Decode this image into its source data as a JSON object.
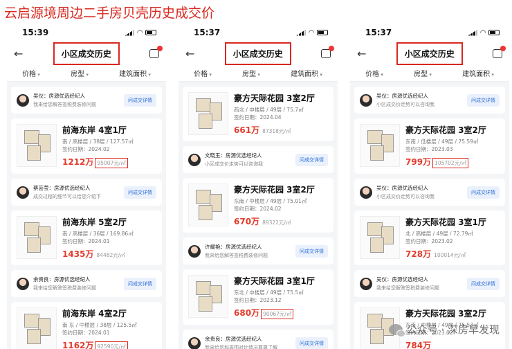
{
  "page_title": "云启源境周边二手房贝壳历史成交价",
  "phones": [
    {
      "time": "15:39",
      "nav_title": "小区成交历史",
      "filters": [
        "价格",
        "房型",
        "建筑面积"
      ],
      "cards": [
        {
          "kind": "agent",
          "name": "吴仪：房源优选经纪人",
          "desc": "我来给您解答签税费装修问题",
          "btn": "问成交详情"
        },
        {
          "kind": "listing",
          "title": "前海东岸 4室1厅",
          "spec": "南 / 高楼层 / 38层 / 127.57㎡",
          "date": "签约日期：2024.02",
          "total": "1212万",
          "unit": "95007元/㎡",
          "highlight": true
        },
        {
          "kind": "agent",
          "name": "蔡芸莹：房源优选经纪人",
          "desc": "成交过程的细节可以给您介绍下",
          "btn": "问成交详情"
        },
        {
          "kind": "listing",
          "title": "前海东岸 5室2厅",
          "spec": "南 / 高楼层 / 36层 / 169.86㎡",
          "date": "签约日期：2024.01",
          "total": "1435万",
          "unit": "84482元/㎡",
          "highlight": false
        },
        {
          "kind": "agent",
          "name": "余贵良：房源优选经纪人",
          "desc": "我来给您解答签税费装修问题",
          "btn": "问成交详情"
        },
        {
          "kind": "listing",
          "title": "前海东岸 4室2厅",
          "spec": "南 东 / 中楼层 / 38层 / 125.5㎡",
          "date": "签约日期：2024.01",
          "total": "1162万",
          "unit": "92590元/㎡",
          "highlight": true
        }
      ]
    },
    {
      "time": "15:37",
      "nav_title": "小区成交历史",
      "filters": [
        "价格",
        "房型",
        "建筑面积"
      ],
      "cards": [
        {
          "kind": "listing",
          "title": "豪方天际花园 3室2厅",
          "spec": "西北 / 中楼层 / 49层 / 75.7㎡",
          "date": "签约日期：2024.04",
          "total": "661万",
          "unit": "87318元/㎡",
          "highlight": false
        },
        {
          "kind": "agent",
          "name": "文晓玉：房源优选经纪人",
          "desc": "小区成交价走势可以咨询我",
          "btn": "问成交详情"
        },
        {
          "kind": "listing",
          "title": "豪方天际花园 3室2厅",
          "spec": "东南 / 中楼层 / 49层 / 75.01㎡",
          "date": "签约日期：2024.02",
          "total": "670万",
          "unit": "89322元/㎡",
          "highlight": false
        },
        {
          "kind": "agent",
          "name": "许耀艳：房源优选经纪人",
          "desc": "我来给您解答签税费装修问题",
          "btn": "问成交详情"
        },
        {
          "kind": "listing",
          "title": "豪方天际花园 3室1厅",
          "spec": "东北 / 中楼层 / 49层 / 75.5㎡",
          "date": "签约日期：2023.12",
          "total": "680万",
          "unit": "90067元/㎡",
          "highlight": true
        },
        {
          "kind": "agent",
          "name": "余贵良：房源优选经纪人",
          "desc": "我来给您和周围对比情况算算了解",
          "btn": "问成交详情"
        }
      ]
    },
    {
      "time": "15:37",
      "nav_title": "小区成交历史",
      "filters": [
        "价格",
        "房型",
        "建筑面积"
      ],
      "cards": [
        {
          "kind": "agent",
          "name": "吴仪：房源优选经纪人",
          "desc": "小区成交价走势可以咨询我",
          "btn": "问成交详情"
        },
        {
          "kind": "listing",
          "title": "豪方天际花园 3室2厅",
          "spec": "东南 / 低楼层 / 49层 / 75.59㎡",
          "date": "签约日期：2023.03",
          "total": "799万",
          "unit": "105702元/㎡",
          "highlight": true
        },
        {
          "kind": "agent",
          "name": "吴仪：房源优选经纪人",
          "desc": "小区成交价走势可以咨询我",
          "btn": "问成交详情"
        },
        {
          "kind": "listing",
          "title": "豪方天际花园 3室1厅",
          "spec": "北 / 高楼层 / 49层 / 72.79㎡",
          "date": "签约日期：2023.02",
          "total": "728万",
          "unit": "100014元/㎡",
          "highlight": false
        },
        {
          "kind": "agent",
          "name": "吴仪：房源优选经纪人",
          "desc": "我来给您解答签税费装修问题",
          "btn": "问成交详情"
        },
        {
          "kind": "listing",
          "title": "豪方天际花园 3室2厅",
          "spec": "东南 / 中楼层 / 49层 / 75.53㎡",
          "date": "签约日期：2023.02",
          "total": "784万",
          "unit": "",
          "highlight": false
        }
      ]
    }
  ],
  "watermark": "公众号 · 深房早发现"
}
